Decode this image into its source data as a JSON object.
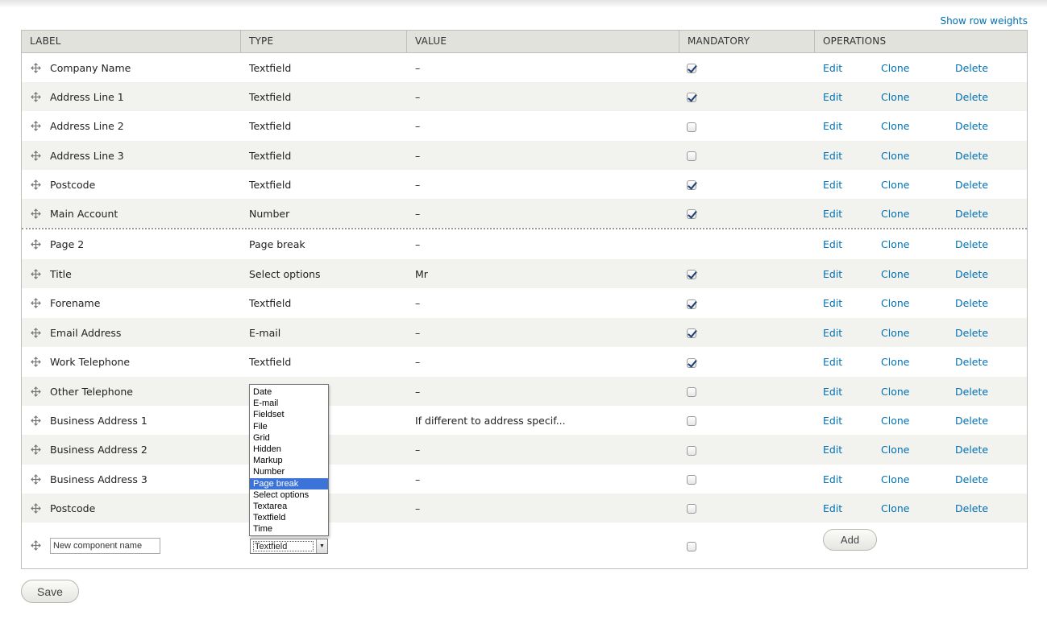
{
  "links": {
    "show_row_weights": "Show row weights"
  },
  "columns": [
    "LABEL",
    "TYPE",
    "VALUE",
    "MANDATORY",
    "OPERATIONS"
  ],
  "ops": {
    "edit": "Edit",
    "clone": "Clone",
    "delete": "Delete"
  },
  "rows": [
    {
      "label": "Company Name",
      "type": "Textfield",
      "value": "–",
      "mandatory": true
    },
    {
      "label": "Address Line 1",
      "type": "Textfield",
      "value": "–",
      "mandatory": true
    },
    {
      "label": "Address Line 2",
      "type": "Textfield",
      "value": "–",
      "mandatory": false
    },
    {
      "label": "Address Line 3",
      "type": "Textfield",
      "value": "–",
      "mandatory": false
    },
    {
      "label": "Postcode",
      "type": "Textfield",
      "value": "–",
      "mandatory": true
    },
    {
      "label": "Main Account",
      "type": "Number",
      "value": "–",
      "mandatory": true
    },
    {
      "label": "Page 2",
      "type": "Page break",
      "value": "–",
      "mandatory": null,
      "page_break": true
    },
    {
      "label": "Title",
      "type": "Select options",
      "value": "Mr",
      "mandatory": true
    },
    {
      "label": "Forename",
      "type": "Textfield",
      "value": "–",
      "mandatory": true
    },
    {
      "label": "Email Address",
      "type": "E-mail",
      "value": "–",
      "mandatory": true
    },
    {
      "label": "Work Telephone",
      "type": "Textfield",
      "value": "–",
      "mandatory": true
    },
    {
      "label": "Other Telephone",
      "type": "",
      "value": "–",
      "mandatory": false
    },
    {
      "label": "Business Address 1",
      "type": "",
      "value": "If different to address specif...",
      "mandatory": false
    },
    {
      "label": "Business Address 2",
      "type": "",
      "value": "–",
      "mandatory": false
    },
    {
      "label": "Business Address 3",
      "type": "",
      "value": "–",
      "mandatory": false
    },
    {
      "label": "Postcode",
      "type": "",
      "value": "–",
      "mandatory": false
    }
  ],
  "new_component": {
    "name_value": "New component name",
    "type_selected": "Textfield",
    "mandatory": false,
    "add_label": "Add"
  },
  "type_options": [
    "Date",
    "E-mail",
    "Fieldset",
    "File",
    "Grid",
    "Hidden",
    "Markup",
    "Number",
    "Page break",
    "Select options",
    "Textarea",
    "Textfield",
    "Time"
  ],
  "type_options_highlighted": "Page break",
  "save_label": "Save",
  "icons": {
    "drag_handle": "move-cross-icon",
    "checkbox": "checkmark-icon",
    "select_arrow": "chevron-down-icon"
  },
  "colors": {
    "link": "#0071b3",
    "header_bg": "#e1e2dc",
    "row_alt_bg": "#f2f2ee",
    "highlight": "#3b73d9",
    "checkmark": "#1e3f73"
  }
}
